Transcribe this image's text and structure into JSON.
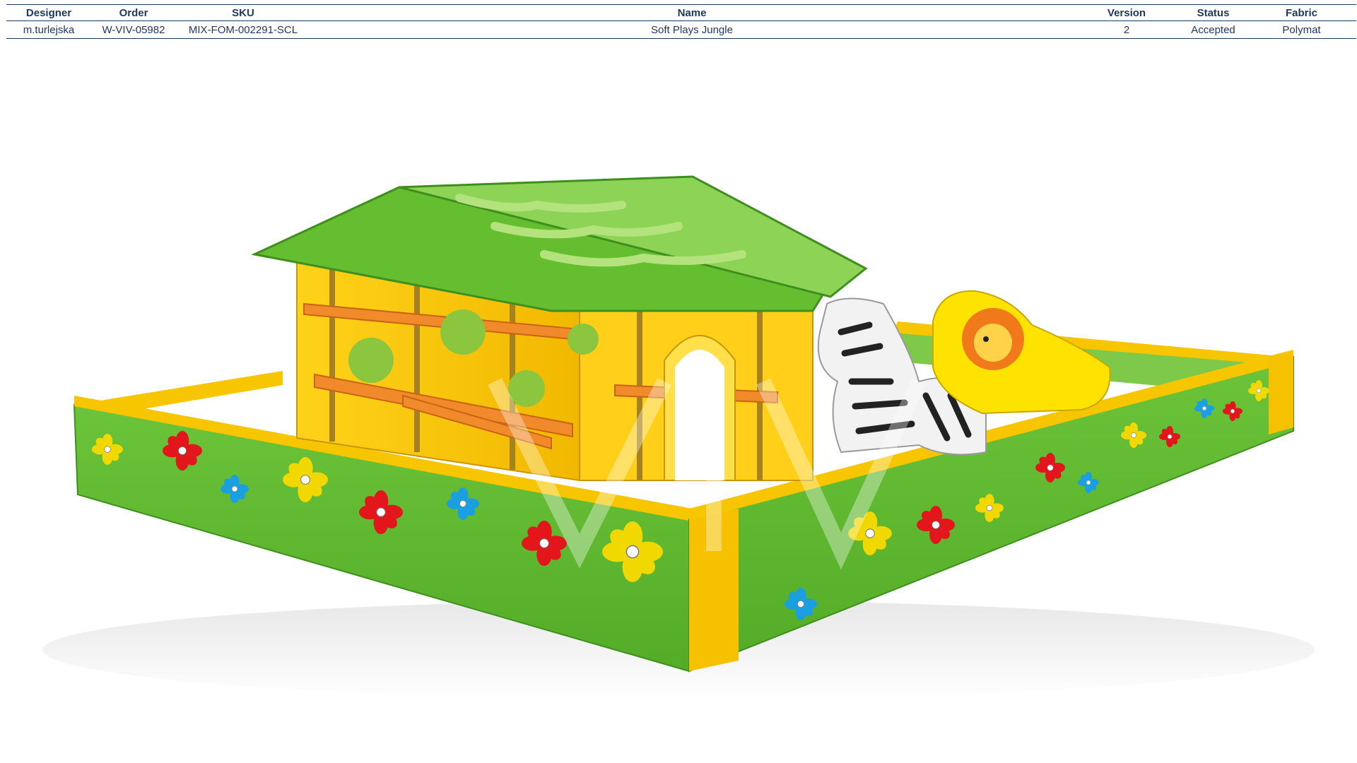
{
  "spec": {
    "headers": {
      "designer": "Designer",
      "order": "Order",
      "sku": "SKU",
      "name": "Name",
      "version": "Version",
      "status": "Status",
      "fabric": "Fabric"
    },
    "row": {
      "designer": "m.turlejska",
      "order": "W-VIV-05982",
      "sku": "MIX-FOM-002291-SCL",
      "name": "Soft Plays Jungle",
      "version": "2",
      "status": "Accepted",
      "fabric": "Polymat"
    }
  },
  "render": {
    "subject": "soft-play-jungle-house-with-flower-wall-enclosure-zebra-and-lion",
    "colors": {
      "green": "#5cb82e",
      "dark_green": "#3f8f1e",
      "yellow": "#f5c400",
      "light_yellow": "#ffe24a",
      "orange": "#f07a1a",
      "red_flower": "#e3161c",
      "blue_flower": "#1a9fe0",
      "header_text": "#1f3864"
    }
  }
}
